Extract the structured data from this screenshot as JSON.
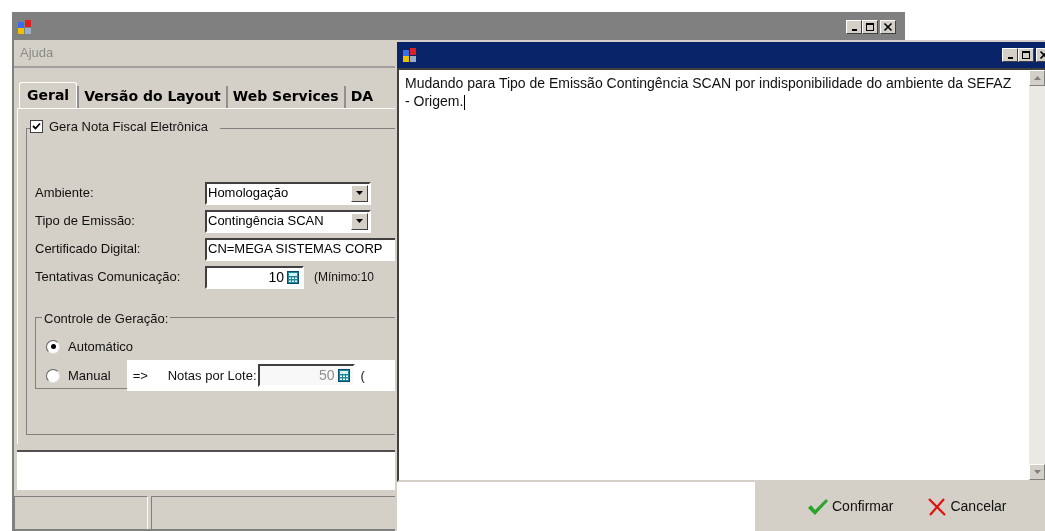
{
  "main_window": {
    "menu": [
      {
        "label": "Ajuda",
        "disabled": true
      }
    ],
    "tabs": [
      {
        "label": "Geral",
        "selected": true
      },
      {
        "label": "Versão do Layout",
        "selected": false
      },
      {
        "label": "Web Services",
        "selected": false
      },
      {
        "label": "DA",
        "selected": false
      }
    ],
    "nfe_group": {
      "label": "Gera Nota Fiscal Eletrônica",
      "checked": true
    },
    "fields": [
      {
        "kind": "combo",
        "label": "Ambiente:",
        "value": "Homologação"
      },
      {
        "kind": "combo",
        "label": "Tipo de Emissão:",
        "value": "Contingência SCAN"
      },
      {
        "kind": "text",
        "label": "Certificado Digital:",
        "value": "CN=MEGA SISTEMAS CORP"
      },
      {
        "kind": "spin",
        "label": "Tentativas Comunicação:",
        "value": "10",
        "note": "(Mínimo:10"
      }
    ],
    "generation": {
      "label": "Controle de Geração:",
      "options": [
        {
          "label": "Automático",
          "selected": true
        },
        {
          "label": "Manual",
          "selected": false
        }
      ],
      "arrow": "=>",
      "lot_label": "Notas por Lote:",
      "lot_value": "50",
      "lot_disabled": true,
      "lot_note": "("
    }
  },
  "dialog": {
    "text": "Mudando para Tipo de Emissão Contingência SCAN por indisponibilidade do ambiente da SEFAZ - Origem.",
    "buttons": [
      {
        "kind": "confirm",
        "label": "Confirmar"
      },
      {
        "kind": "cancel",
        "label": "Cancelar"
      }
    ]
  }
}
